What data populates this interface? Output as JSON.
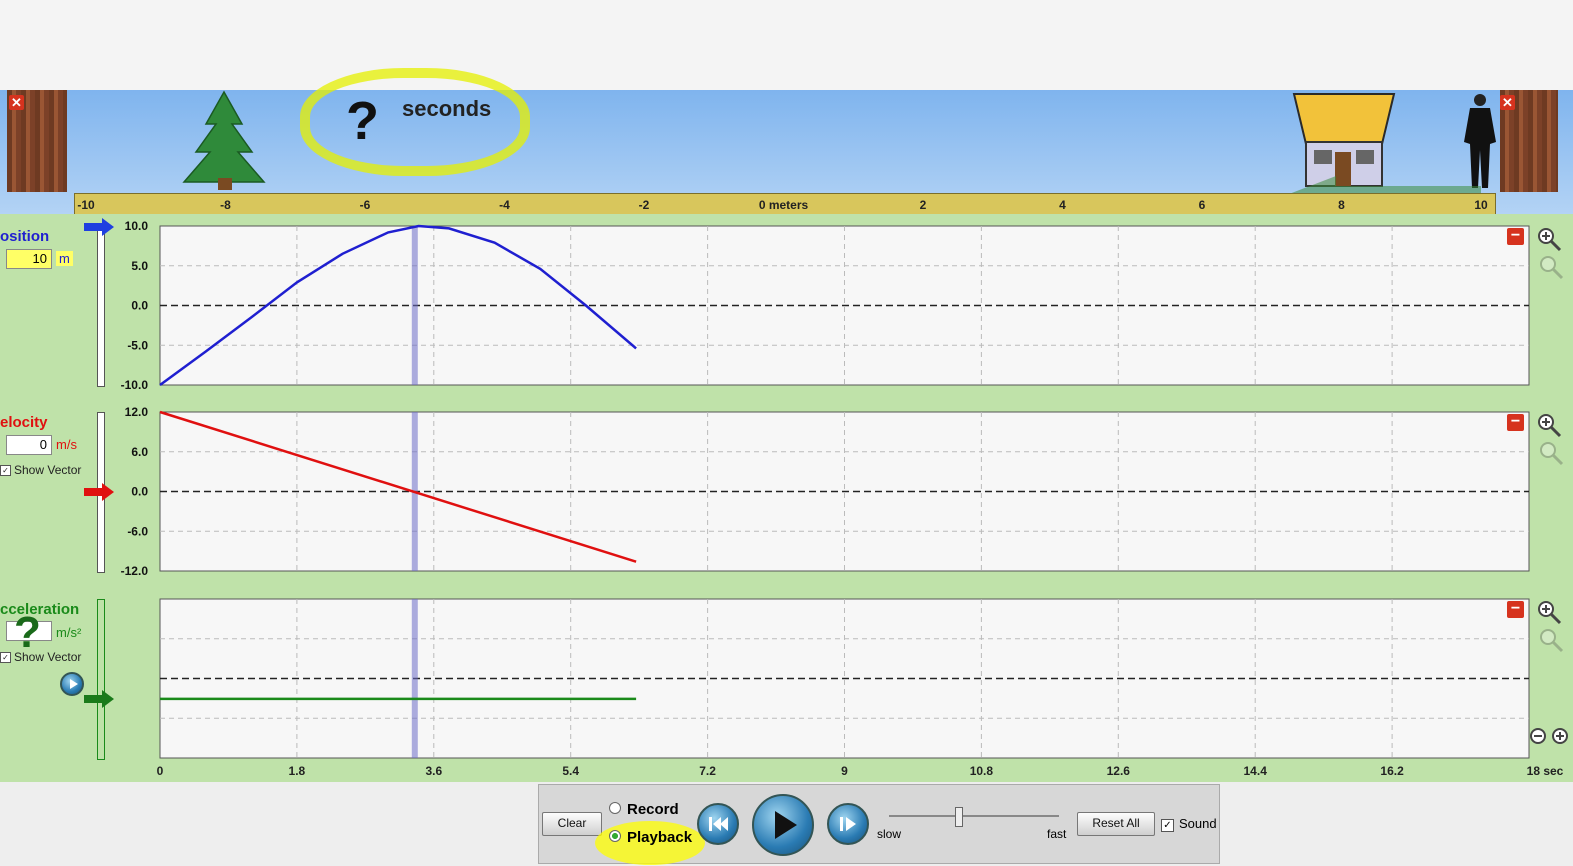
{
  "scene": {
    "seconds_value": "?",
    "seconds_label": "seconds",
    "close_left": "✕",
    "close_right": "✕"
  },
  "ruler": {
    "ticks": [
      "-10",
      "-8",
      "-6",
      "-4",
      "-2",
      "0 meters",
      "2",
      "4",
      "6",
      "8",
      "10"
    ]
  },
  "position": {
    "label": "osition",
    "value": "10",
    "unit": "m",
    "yticks": [
      "10.0",
      "5.0",
      "0.0",
      "-5.0",
      "-10.0"
    ],
    "color": "#1f1fd0"
  },
  "velocity": {
    "label": "elocity",
    "value": "0",
    "unit": "m/s",
    "show_vector": "Show Vector",
    "yticks": [
      "12.0",
      "6.0",
      "0.0",
      "-6.0",
      "-12.0"
    ],
    "color": "#e01010"
  },
  "acceleration": {
    "label": "cceleration",
    "value": "?",
    "unit": "m/s²",
    "show_vector": "Show Vector",
    "color": "#1a8a1a"
  },
  "time_axis": {
    "ticks": [
      "0",
      "1.8",
      "3.6",
      "5.4",
      "7.2",
      "9",
      "10.8",
      "12.6",
      "14.4",
      "16.2",
      "18 sec"
    ]
  },
  "controls": {
    "clear": "Clear",
    "record": "Record",
    "playback": "Playback",
    "slow": "slow",
    "fast": "fast",
    "reset_all": "Reset All",
    "sound": "Sound",
    "check": "✓"
  },
  "chart_data": [
    {
      "type": "line",
      "title": "",
      "ylabel": "osition",
      "xlim": [
        0,
        18
      ],
      "ylim": [
        -10,
        10
      ],
      "series": [
        {
          "x": [
            0,
            0.6,
            1.2,
            1.8,
            2.4,
            3.0,
            3.4,
            3.8,
            4.4,
            5.0,
            5.6,
            6.26
          ],
          "y": [
            -10.0,
            -5.8,
            -1.5,
            2.9,
            6.5,
            9.2,
            10.0,
            9.7,
            7.9,
            4.6,
            0.0,
            -5.4
          ]
        }
      ]
    },
    {
      "type": "line",
      "title": "",
      "ylabel": "elocity",
      "xlim": [
        0,
        18
      ],
      "ylim": [
        -12,
        12
      ],
      "series": [
        {
          "x": [
            0,
            6.26
          ],
          "y": [
            12.0,
            -10.6
          ]
        }
      ]
    },
    {
      "type": "line",
      "title": "",
      "ylabel": "cceleration",
      "xlim": [
        0,
        18
      ],
      "series": [
        {
          "x": [
            0,
            6.26
          ],
          "y": [
            -3.6,
            -3.6
          ]
        }
      ]
    }
  ]
}
